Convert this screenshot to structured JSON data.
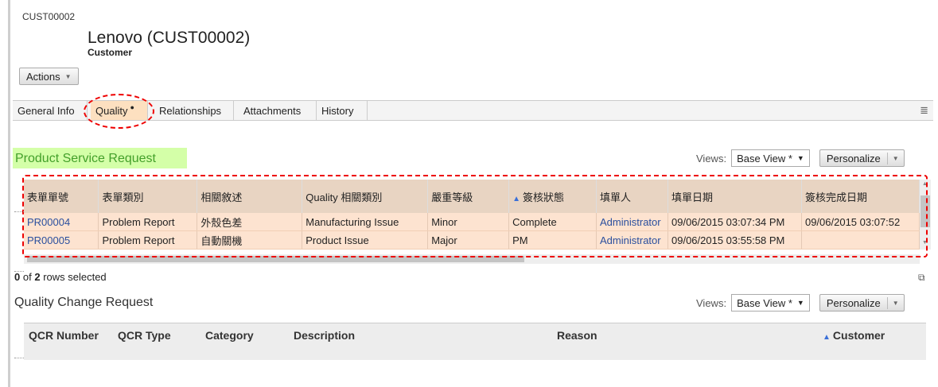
{
  "header": {
    "record_id": "CUST00002",
    "title": "Lenovo (CUST00002)",
    "subtitle": "Customer",
    "actions_label": "Actions"
  },
  "tabs": [
    {
      "label": "General Info"
    },
    {
      "label": "Quality"
    },
    {
      "label": "Relationships"
    },
    {
      "label": "Attachments"
    },
    {
      "label": "History"
    }
  ],
  "product_service_request": {
    "title": "Product Service Request",
    "views_label": "Views:",
    "view_value": "Base View *",
    "personalize_label": "Personalize",
    "columns": [
      "表單單號",
      "表單類別",
      "相關敘述",
      "Quality 相關類別",
      "嚴重等級",
      "簽核狀態",
      "填單人",
      "填單日期",
      "簽核完成日期"
    ],
    "rows": [
      [
        "PR00004",
        "Problem Report",
        "外殼色差",
        "Manufacturing Issue",
        "Minor",
        "Complete",
        "Administrator",
        "09/06/2015 03:07:34 PM",
        "09/06/2015 03:07:52"
      ],
      [
        "PR00005",
        "Problem Report",
        "自動關機",
        "Product Issue",
        "Major",
        "PM",
        "Administrator",
        "09/06/2015 03:55:58 PM",
        ""
      ]
    ],
    "selection": {
      "count": "0",
      "suffix": "of",
      "total": "2",
      "tail": "rows selected"
    }
  },
  "quality_change_request": {
    "title": "Quality Change Request",
    "views_label": "Views:",
    "view_value": "Base View *",
    "personalize_label": "Personalize",
    "columns": [
      "QCR Number",
      "QCR Type",
      "Category",
      "Description",
      "Reason",
      "Customer"
    ]
  },
  "colors": {
    "annotation": "#e00000",
    "active_tab": "#fde0c0",
    "row_highlight": "#fde3d0",
    "title_highlight": "#d4ffa8"
  }
}
